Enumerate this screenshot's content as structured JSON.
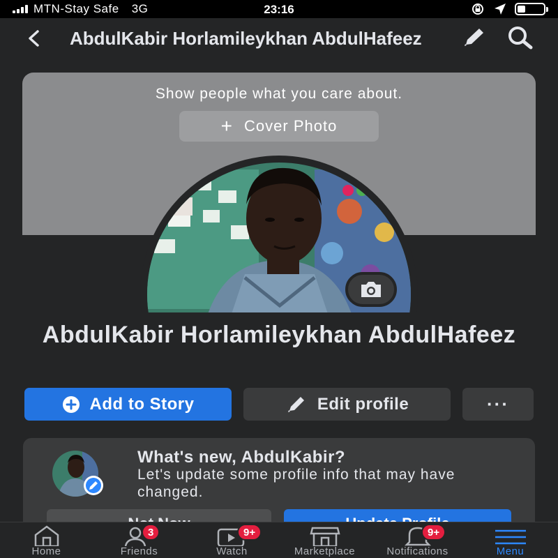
{
  "status_bar": {
    "carrier": "MTN-Stay Safe",
    "network": "3G",
    "time": "23:16",
    "battery_level": 0.3
  },
  "nav": {
    "title": "AbdulKabir Horlamileykhan AbdulHafeez",
    "back_icon": "chevron-left-icon",
    "edit_icon": "pencil-icon",
    "search_icon": "search-icon"
  },
  "cover": {
    "prompt": "Show people what you care about.",
    "button_label": "Cover Photo"
  },
  "profile": {
    "name": "AbdulKabir Horlamileykhan AbdulHafeez"
  },
  "actions": {
    "add_story": "Add to Story",
    "edit_profile": "Edit profile",
    "more": "···"
  },
  "whats_new": {
    "title": "What's new, AbdulKabir?",
    "body": "Let's update some profile info that may have changed.",
    "left_button": "Not Now",
    "right_button": "Update Profile"
  },
  "tab_bar": {
    "tabs": [
      {
        "label": "Home",
        "icon": "home-icon",
        "badge": ""
      },
      {
        "label": "Friends",
        "icon": "friends-icon",
        "badge": "3"
      },
      {
        "label": "Watch",
        "icon": "watch-icon",
        "badge": "9+"
      },
      {
        "label": "Marketplace",
        "icon": "marketplace-icon",
        "badge": ""
      },
      {
        "label": "Notifications",
        "icon": "bell-icon",
        "badge": "9+"
      },
      {
        "label": "Menu",
        "icon": "menu-icon",
        "badge": ""
      }
    ]
  },
  "colors": {
    "accent": "#2374e1",
    "badge": "#e41e3f",
    "background": "#242526"
  }
}
